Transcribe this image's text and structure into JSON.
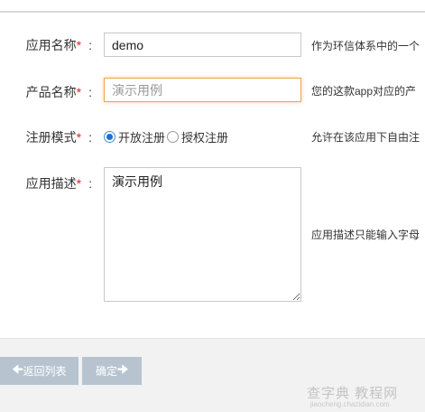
{
  "form": {
    "required_mark": "*",
    "colon": ":",
    "app_name": {
      "label": "应用名称",
      "value": "demo",
      "hint": "作为环信体系中的一个"
    },
    "product_name": {
      "label": "产品名称",
      "placeholder": "演示用例",
      "hint": "您的这款app对应的产"
    },
    "register_mode": {
      "label": "注册模式",
      "options": [
        {
          "label": "开放注册",
          "checked": true
        },
        {
          "label": "授权注册",
          "checked": false
        }
      ],
      "hint": "允许在该应用下自由注"
    },
    "description": {
      "label": "应用描述",
      "value": "演示用例",
      "hint": "应用描述只能输入字母"
    }
  },
  "footer": {
    "back_label": "返回列表",
    "back_icon": "arrow-left-icon",
    "confirm_label": "确定",
    "confirm_icon": "arrow-right-icon"
  },
  "watermark": {
    "main": "查字典 教程网",
    "sub": "jiaocheng.chazidian.com"
  }
}
